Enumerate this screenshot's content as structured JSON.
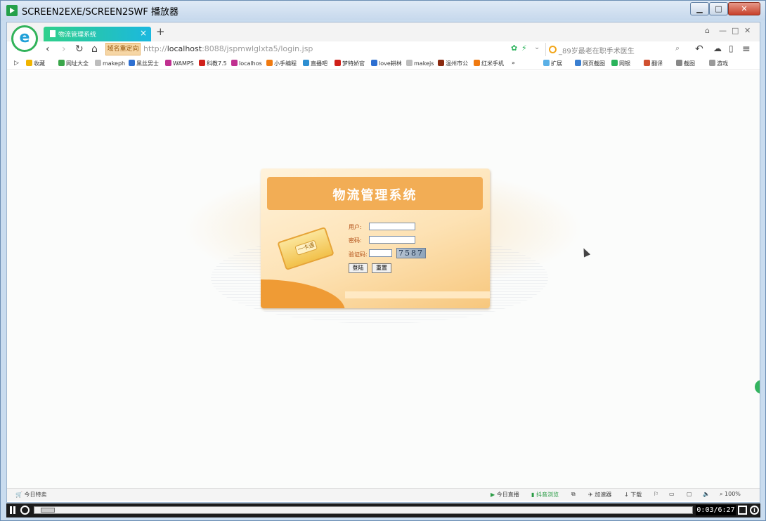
{
  "window": {
    "title": "SCREEN2EXE/SCREEN2SWF 播放器",
    "minimize_label": "▁",
    "maximize_label": "□",
    "close_label": "✕"
  },
  "browser": {
    "logo": "e",
    "tab": {
      "title": "物流管理系统",
      "close": "×"
    },
    "new_tab": "+",
    "address": {
      "redirect_badge": "域名重定向",
      "prefix": "http://",
      "host": "localhost",
      "rest": ":8088/jspmwlglxta5/login.jsp"
    },
    "search": {
      "text": "_89岁最老在职手术医生"
    },
    "bookmarks": [
      {
        "label": "收藏",
        "color": "#f0b400"
      },
      {
        "label": "网址大全",
        "color": "#3aa64a"
      },
      {
        "label": "makeph",
        "color": "#bdbdbd"
      },
      {
        "label": "黑丝男士",
        "color": "#2d6fd1"
      },
      {
        "label": "WAMPS",
        "color": "#c03090"
      },
      {
        "label": "科教7.5",
        "color": "#d0201a"
      },
      {
        "label": "localhos",
        "color": "#c03090"
      },
      {
        "label": "小手编程",
        "color": "#f07a10"
      },
      {
        "label": "直播吧",
        "color": "#2d8ed1"
      },
      {
        "label": "梦特娇官",
        "color": "#d0201a"
      },
      {
        "label": "love耕林",
        "color": "#2d6fd1"
      },
      {
        "label": "makejs",
        "color": "#bdbdbd"
      },
      {
        "label": "温州市公",
        "color": "#8a2a10"
      },
      {
        "label": "红米手机",
        "color": "#f07a10"
      }
    ],
    "bookmark_more": "»",
    "bookmark_tools": [
      "扩展",
      "网页截图",
      "网银",
      "翻译",
      "截图",
      "游戏"
    ]
  },
  "login": {
    "title": "物流管理系统",
    "card_badge": "一卡通",
    "user_label": "用户:",
    "password_label": "密码:",
    "captcha_label": "验证码:",
    "user_value": "",
    "password_value": "",
    "captcha_value": "",
    "captcha_code": "7587",
    "login_button": "登陆",
    "reset_button": "重置"
  },
  "statusbar": {
    "left": "今日特卖",
    "items": [
      "今日直播",
      "抖音浏览",
      "加速器",
      "下载"
    ],
    "zoom": "100%"
  },
  "player": {
    "time": "0:03/6:27",
    "progress": 0.008
  }
}
